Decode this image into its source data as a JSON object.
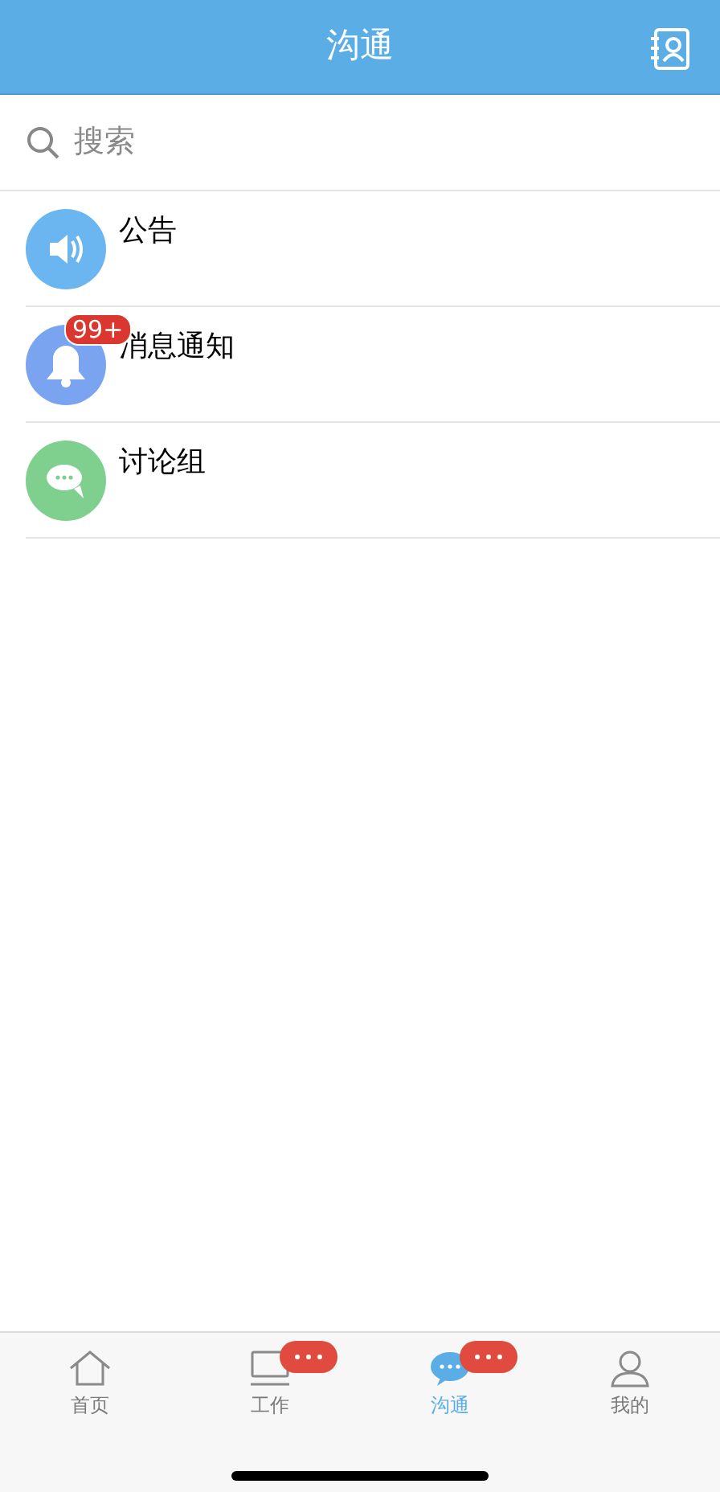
{
  "header": {
    "title": "沟通"
  },
  "search": {
    "placeholder": "搜索"
  },
  "items": [
    {
      "kind": "announcement",
      "label": "公告",
      "color": "#6bb5f0"
    },
    {
      "kind": "notification",
      "label": "消息通知",
      "color": "#7aa3f0",
      "badge": "99+"
    },
    {
      "kind": "discussion",
      "label": "讨论组",
      "color": "#7fcf8f"
    }
  ],
  "tabs": [
    {
      "kind": "home",
      "label": "首页",
      "selected": false,
      "dot_badge": false
    },
    {
      "kind": "work",
      "label": "工作",
      "selected": false,
      "dot_badge": true
    },
    {
      "kind": "chat",
      "label": "沟通",
      "selected": true,
      "dot_badge": true
    },
    {
      "kind": "me",
      "label": "我的",
      "selected": false,
      "dot_badge": false
    }
  ]
}
